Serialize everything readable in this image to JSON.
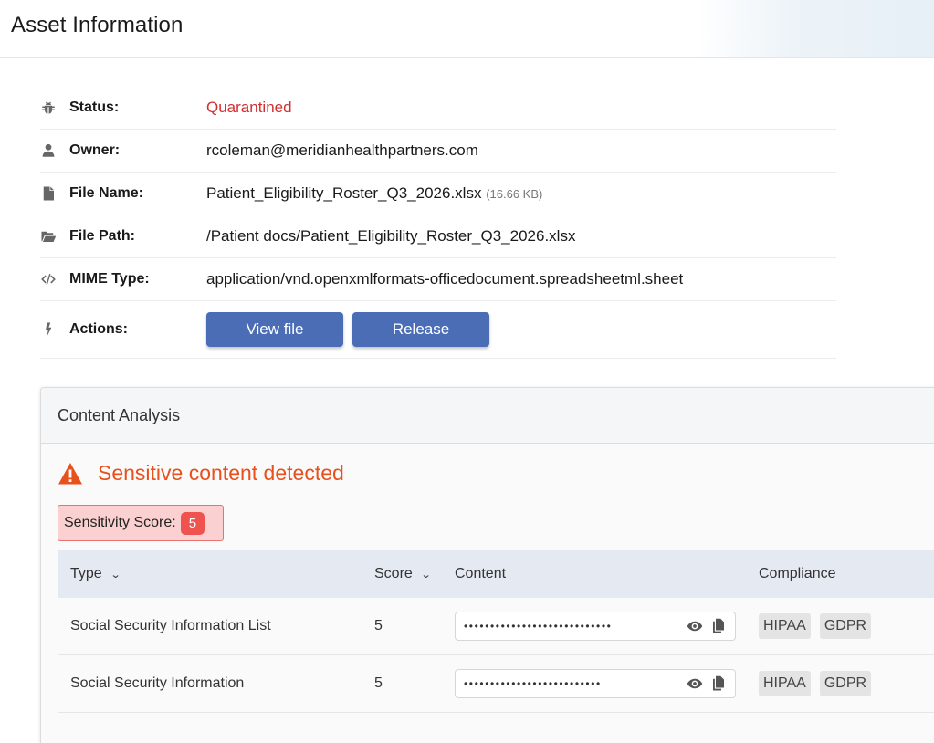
{
  "header": {
    "title": "Asset Information"
  },
  "info": {
    "status": {
      "label": "Status:",
      "value": "Quarantined",
      "icon": "bug-icon",
      "color": "#d32f2f"
    },
    "owner": {
      "label": "Owner:",
      "value": "rcoleman@meridianhealthpartners.com",
      "icon": "user-icon"
    },
    "file_name": {
      "label": "File Name:",
      "value": "Patient_Eligibility_Roster_Q3_2026.xlsx",
      "size": "(16.66 KB)",
      "icon": "file-icon"
    },
    "file_path": {
      "label": "File Path:",
      "value": "/Patient docs/Patient_Eligibility_Roster_Q3_2026.xlsx",
      "icon": "folder-open-icon"
    },
    "mime_type": {
      "label": "MIME Type:",
      "value": "application/vnd.openxmlformats-officedocument.spreadsheetml.sheet",
      "icon": "code-icon"
    },
    "actions": {
      "label": "Actions:",
      "icon": "bolt-icon",
      "view_label": "View file",
      "release_label": "Release"
    }
  },
  "analysis": {
    "title": "Content Analysis",
    "alert": "Sensitive content detected",
    "score_label": "Sensitivity Score:",
    "score": "5",
    "columns": {
      "type": "Type",
      "score": "Score",
      "content": "Content",
      "compliance": "Compliance"
    },
    "rows": [
      {
        "type": "Social Security Information List",
        "score": "5",
        "masked": "••••••••••••••••••••••••••••",
        "tags": [
          "HIPAA",
          "GDPR"
        ]
      },
      {
        "type": "Social Security Information",
        "score": "5",
        "masked": "••••••••••••••••••••••••••",
        "tags": [
          "HIPAA",
          "GDPR"
        ]
      }
    ]
  },
  "colors": {
    "accent": "#4a6db5",
    "alert": "#e8501c",
    "danger": "#ef5350"
  }
}
